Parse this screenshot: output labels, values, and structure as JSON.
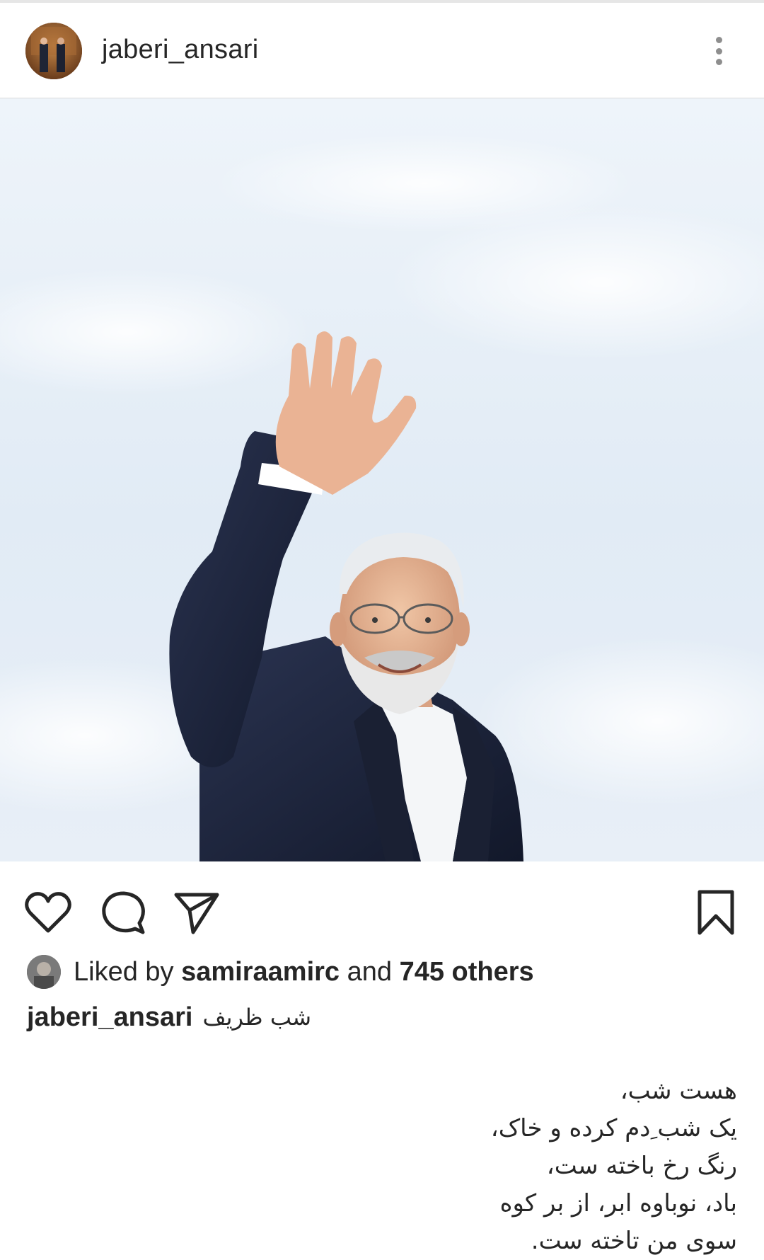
{
  "post": {
    "username": "jaberi_ansari",
    "avatar_icon": "profile-avatar",
    "more_icon": "more-vertical-icon"
  },
  "photo": {
    "subject": "smiling-man-waving-photo",
    "sky_color": "#e4edf6",
    "suit_color": "#1b2235"
  },
  "actions": {
    "like_icon": "heart-icon",
    "comment_icon": "comment-icon",
    "share_icon": "send-icon",
    "save_icon": "bookmark-icon"
  },
  "likes": {
    "prefix": "Liked by",
    "user": "samiraamirc",
    "middle": "and",
    "count_text": "745 others"
  },
  "caption": {
    "username": "jaberi_ansari",
    "text": "شب ظریف",
    "poem": [
      "هست شب،",
      "یک شب ِدم کرده و خاک،",
      "رنگ رخ باخته ست،",
      "باد، نوباوه ابر، از بر کوه",
      "سوی من تاخته ست."
    ]
  }
}
